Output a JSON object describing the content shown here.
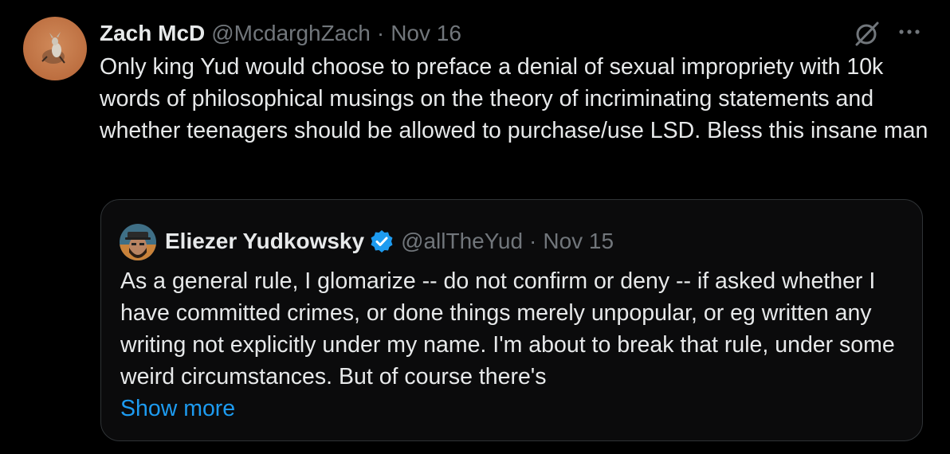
{
  "tweet": {
    "author_name": "Zach McD",
    "handle": "@McdarghZach",
    "separator": "·",
    "date": "Nov 16",
    "avatar_icon": "profile-photo-animal-on-red-dirt",
    "grok_icon": "grok-icon",
    "more_icon": "more-horizontal-icon",
    "text": "Only king Yud would choose to preface a denial of sexual impropriety with 10k words of philosophical musings on the theory of incriminating statements and whether teenagers should be allowed to purchase/use LSD. Bless this insane man"
  },
  "quoted_tweet": {
    "author_name": "Eliezer Yudkowsky",
    "verified_icon": "verified-badge-icon",
    "handle": "@allTheYud",
    "separator": "·",
    "date": "Nov 15",
    "avatar_icon": "profile-photo-bearded-man-with-hat",
    "text": "As a general rule, I glomarize -- do not confirm or deny -- if asked whether I have committed crimes, or done things merely unpopular, or eg written any writing not explicitly under my name.  I'm about to break that rule, under some weird circumstances.  But of course there's",
    "show_more_label": "Show more"
  },
  "colors": {
    "background": "#000000",
    "primary_text": "#e7e9ea",
    "secondary_text": "#71767b",
    "link": "#1d9bf0",
    "border": "#2f3336"
  }
}
